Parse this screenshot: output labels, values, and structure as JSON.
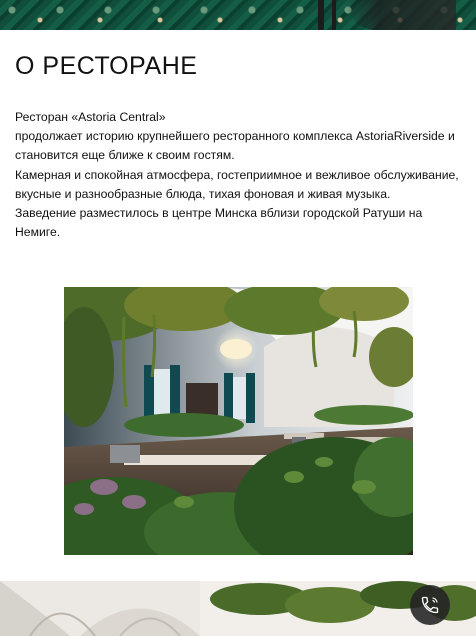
{
  "about_section": {
    "title": "О РЕСТОРАНЕ",
    "paragraphs": [
      "Ресторан «Astoria Central»",
      "продолжает историю крупнейшего ресторанного комплекса AstoriaRiverside и становится еще ближе к своим гостям.",
      "Камерная и спокойная атмосфера, гостеприимное и вежливое обслуживание, вкусные и разнообразные блюда, тихая фоновая и живая музыка.",
      "Заведение разместилось в центре Минска вблизи городской Ратуши на Немиге."
    ]
  },
  "floating_actions": {
    "call_icon": "phone-icon"
  },
  "colors": {
    "banner_green": "#0f4f3c",
    "call_button_bg": "#232323",
    "text": "#111111",
    "background": "#ffffff"
  }
}
